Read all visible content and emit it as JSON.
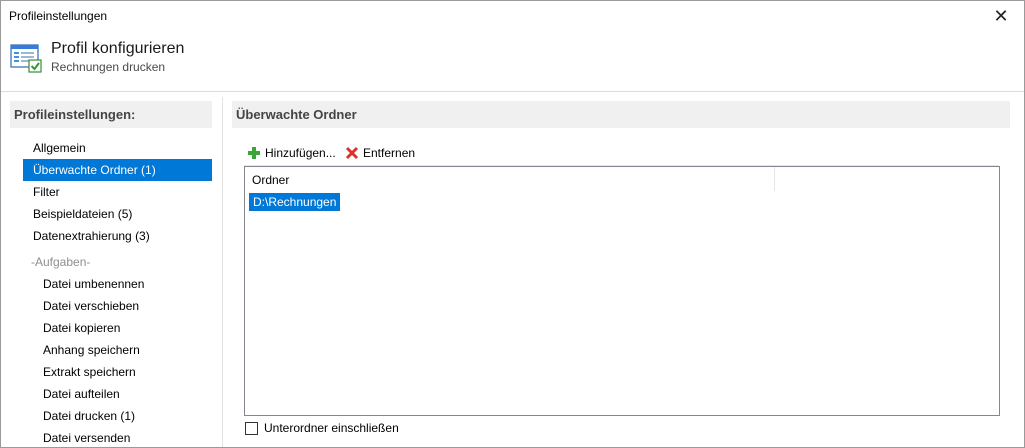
{
  "window": {
    "title": "Profileinstellungen",
    "close_glyph": "✕"
  },
  "header": {
    "title": "Profil konfigurieren",
    "subtitle": "Rechnungen drucken",
    "icon": "window-check-icon"
  },
  "sidebar": {
    "heading": "Profileinstellungen:",
    "items": [
      {
        "label": "Allgemein"
      },
      {
        "label": "Überwachte Ordner (1)",
        "selected": true
      },
      {
        "label": "Filter"
      },
      {
        "label": "Beispieldateien (5)"
      },
      {
        "label": "Datenextrahierung (3)"
      }
    ],
    "group_label": "-Aufgaben-",
    "sub_items": [
      {
        "label": "Datei umbenennen"
      },
      {
        "label": "Datei verschieben"
      },
      {
        "label": "Datei kopieren"
      },
      {
        "label": "Anhang speichern"
      },
      {
        "label": "Extrakt speichern"
      },
      {
        "label": "Datei aufteilen"
      },
      {
        "label": "Datei drucken (1)"
      },
      {
        "label": "Datei versenden"
      }
    ]
  },
  "main": {
    "heading": "Überwachte Ordner",
    "toolbar": {
      "add_label": "Hinzufügen...",
      "add_icon": "plus-icon",
      "remove_label": "Entfernen",
      "remove_icon": "x-icon"
    },
    "list": {
      "column_header": "Ordner",
      "rows": [
        "D:\\Rechnungen"
      ]
    },
    "checkbox_label": "Unterordner einschließen",
    "checkbox_checked": false
  },
  "colors": {
    "selection": "#0078d7",
    "section_bg": "#f0f0f0",
    "add_green": "#3aa63a",
    "remove_red": "#d9342b"
  }
}
